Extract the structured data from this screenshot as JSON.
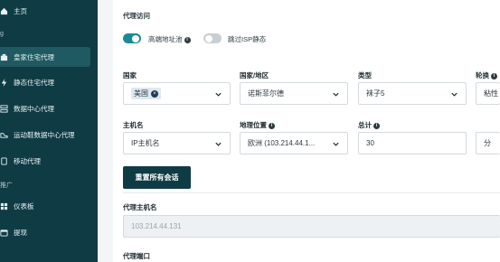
{
  "sidebar": {
    "items": [
      {
        "label": "主页",
        "icon": "home-icon"
      },
      {
        "label": "皇家住宅代理",
        "icon": "house-icon"
      },
      {
        "label": "静态住宅代理",
        "icon": "bolt-icon"
      },
      {
        "label": "数据中心代理",
        "icon": "server-icon"
      },
      {
        "label": "运动鞋数据中心代理",
        "icon": "shoe-icon"
      },
      {
        "label": "移动代理",
        "icon": "mobile-icon"
      },
      {
        "label": "仪表板",
        "icon": "dashboard-icon"
      },
      {
        "label": "提现",
        "icon": "wallet-icon"
      }
    ],
    "section_top": "g",
    "section_affiliate": "推广"
  },
  "proxy_access": {
    "title": "代理访问",
    "toggle_high_end": "高端地址池",
    "toggle_skip_isp": "跳过ISP静态"
  },
  "form": {
    "country_label": "国家",
    "country_value": "美国",
    "region_label": "国家/地区",
    "region_value": "诺斯菲尔德",
    "type_label": "类型",
    "type_value": "袜子5",
    "rotation_label": "轮换",
    "rotation_value": "粘性",
    "hostname_label": "主机名",
    "hostname_value": "IP主机名",
    "location_label": "地理位置",
    "location_value": "欧洲 (103.214.44.1...",
    "total_label": "总计",
    "total_value": "30",
    "unit_value": "分"
  },
  "actions": {
    "reset_sessions": "重置所有会话"
  },
  "proxy_host": {
    "label": "代理主机名",
    "value": "103.214.44.131"
  },
  "proxy_port": {
    "label": "代理端口"
  },
  "colors": {
    "sidebar_bg": "#0f3b45",
    "accent": "#1a8b93"
  }
}
